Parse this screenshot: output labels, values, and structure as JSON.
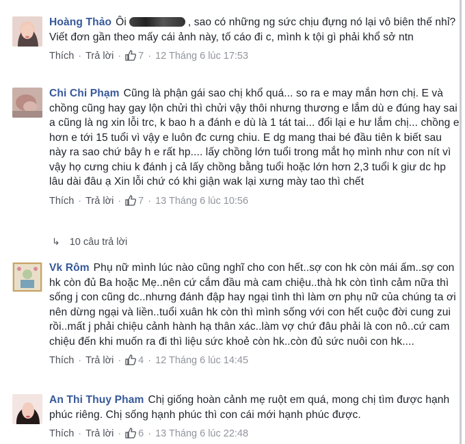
{
  "comments": [
    {
      "author": "Hoàng Thảo",
      "prefix": "Ôi",
      "text": ", sao có những ng sức chịu đựng nó lại vô biên thế nhỉ? Viết đơn gần theo mấy cái ảnh này, tố cáo đi c, mình k tội gì phải khổ sở ntn",
      "actions": {
        "like": "Thích",
        "reply": "Trả lời",
        "count": "7",
        "time": "12 Tháng 6 lúc 17:53"
      }
    },
    {
      "author": "Chi Chi Phạm",
      "text": "Cũng là phận gái sao chị khổ quá... so ra e may mắn hơn chị. E và chồng cũng hay gay lộn chửi thì chửi vậy thôi nhưng thương e lắm dù e đúng hay sai a cũng là ng xin lỗi trc, k bao h a đánh e dù là 1 tát tai... đổi lại e hư lắm chị... chồng e hơn e tới 15 tuổi vì vậy e luôn đc cưng chiu. E dg mang thai bé đầu tiên k biết sau này ra sao chứ bây h e rất hp.... lấy chồng lớn tuổi trong mắt họ mình như con nít vì vậy họ cưng chiu k đánh j cả lấy chồng bằng tuổi hoặc lớn hơn 2,3 tuổi k giư dc hp lâu dài đâu ạ Xin lỗi chứ có khi giận wak lại xưng mày tao thì chết",
      "actions": {
        "like": "Thích",
        "reply": "Trả lời",
        "count": "7",
        "time": "13 Tháng 6 lúc 10:56"
      }
    },
    {
      "author": "Vk Rôm",
      "text": "Phụ nữ mình lúc nào cũng nghĩ cho con hết..sợ con hk còn mái ấm..sợ con hk còn đủ Ba hoặc Mẹ..nên cứ cắm đầu mà cam chiệu..thà hk còn tình cảm nữa thì sống j con cũng dc..nhưng đánh đập hay ngại tình thì làm ơn phụ nữ của chúng ta ơi nên dừng ngại và liền..tuổi xuân hk còn thì mình sống với con hết cuộc đời cung zui rồi..mất j phải chiệu cảnh hành hạ thân xác..làm vợ chứ đâu phải là con nô..cứ cam chiệu đến khi muốn ra đi thì liệu sức khoẻ còn hk..còn đủ sức nuôi con hk....",
      "actions": {
        "like": "Thích",
        "reply": "Trả lời",
        "count": "4",
        "time": "12 Tháng 6 lúc 14:45"
      }
    },
    {
      "author": "An Thi Thuy Pham",
      "text": "Chị giống hoàn cảnh mẹ ruột em quá, mong chị tìm được hạnh phúc riêng. Chị sống hạnh phúc thì con cái mới hạnh phúc được.",
      "actions": {
        "like": "Thích",
        "reply": "Trả lời",
        "count": "6",
        "time": "13 Tháng 6 lúc 22:48"
      }
    }
  ],
  "replies_link": "10 câu trả lời",
  "colors": {
    "author": "#365899",
    "meta": "#90949c",
    "text": "#1d2129",
    "like_icon": "#4b4f56"
  }
}
